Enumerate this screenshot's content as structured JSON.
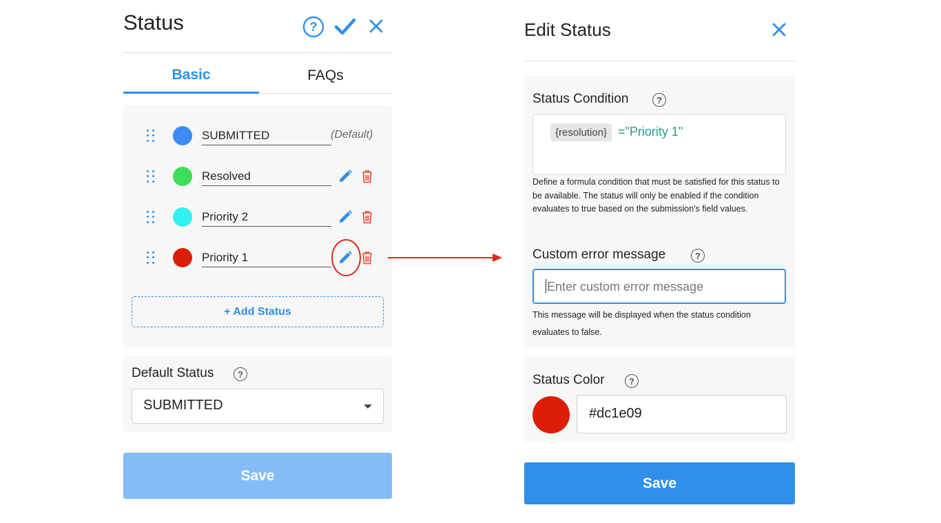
{
  "left_panel": {
    "title": "Status",
    "tabs": [
      {
        "label": "Basic",
        "active": true
      },
      {
        "label": "FAQs",
        "active": false
      }
    ],
    "statuses": [
      {
        "name": "SUBMITTED",
        "color": "#3b8cf5",
        "default_label": "(Default)"
      },
      {
        "name": "Resolved",
        "color": "#3dde5a"
      },
      {
        "name": "Priority 2",
        "color": "#32f1f1"
      },
      {
        "name": "Priority 1",
        "color": "#dc1e09",
        "highlighted": true
      }
    ],
    "add_status_label": "+ Add Status",
    "default_status": {
      "label": "Default Status",
      "selected": "SUBMITTED"
    },
    "save_label": "Save",
    "header_icons": [
      "help-circle-icon",
      "check-icon",
      "close-icon"
    ]
  },
  "right_panel": {
    "title": "Edit Status",
    "condition": {
      "label": "Status Condition",
      "field_chip": "{resolution}",
      "expression": "=\"Priority 1\"",
      "help": "Define a formula condition that must be satisfied for this status to be available. The status will only be enabled if the condition evaluates to true based on the submission's field values."
    },
    "error_message": {
      "label": "Custom error message",
      "placeholder": "Enter custom error message",
      "help": "This message will be displayed when the status condition evaluates to false."
    },
    "color": {
      "label": "Status Color",
      "value": "#dc1e09"
    },
    "save_label": "Save"
  },
  "colors": {
    "accent": "#2f8fe9",
    "accent_disabled": "#84bcf8",
    "danger": "#e8462d",
    "annotation": "#e02a1a"
  }
}
